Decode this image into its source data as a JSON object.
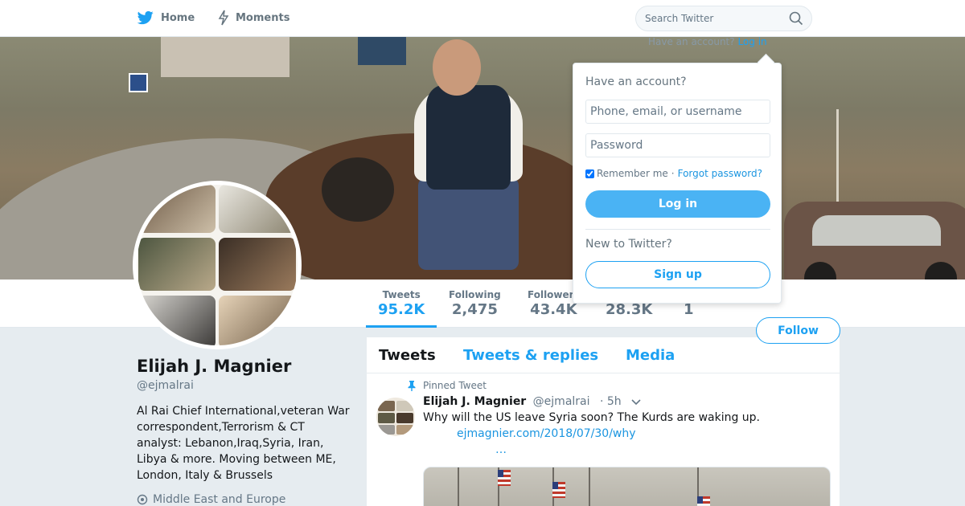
{
  "nav": {
    "home_label": "Home",
    "moments_label": "Moments",
    "search_placeholder": "Search Twitter",
    "have_account_text": "Have an account?",
    "login_link": "Log in"
  },
  "profile": {
    "name": "Elijah J. Magnier",
    "handle": "@ejmalrai",
    "bio": "Al Rai Chief International,veteran War correspondent,Terrorism & CT analyst: Lebanon,Iraq,Syria, Iran, Libya & more. Moving between ME, London, Italy & Brussels",
    "location": "Middle East and Europe"
  },
  "stats": [
    {
      "label": "Tweets",
      "value": "95.2K"
    },
    {
      "label": "Following",
      "value": "2,475"
    },
    {
      "label": "Followers",
      "value": "43.4K"
    },
    {
      "label": "",
      "value": "28.3K"
    },
    {
      "label": "",
      "value": "1"
    }
  ],
  "follow_label": "Follow",
  "timeline": {
    "tabs": [
      "Tweets",
      "Tweets & replies",
      "Media"
    ],
    "pinned_label": "Pinned Tweet",
    "tweet": {
      "name": "Elijah J. Magnier",
      "handle": "@ejmalrai",
      "time": "· 5h",
      "text": "Why will the US leave Syria soon? The Kurds are waking up.",
      "link": "ejmagnier.com/2018/07/30/why",
      "ellipsis": "…"
    }
  },
  "login": {
    "title": "Have an account?",
    "username_placeholder": "Phone, email, or username",
    "password_placeholder": "Password",
    "remember_label": "Remember me",
    "separator": "·",
    "forgot_label": "Forgot password?",
    "login_button": "Log in",
    "new_text": "New to Twitter?",
    "signup_button": "Sign up"
  },
  "colors": {
    "accent": "#1da1f2",
    "login_button": "#4ab3f4",
    "background": "#e6ecf0"
  },
  "icons": [
    "twitter-bird-icon",
    "moments-bolt-icon",
    "search-icon",
    "pin-icon",
    "chevron-down-icon",
    "location-pin-icon"
  ]
}
